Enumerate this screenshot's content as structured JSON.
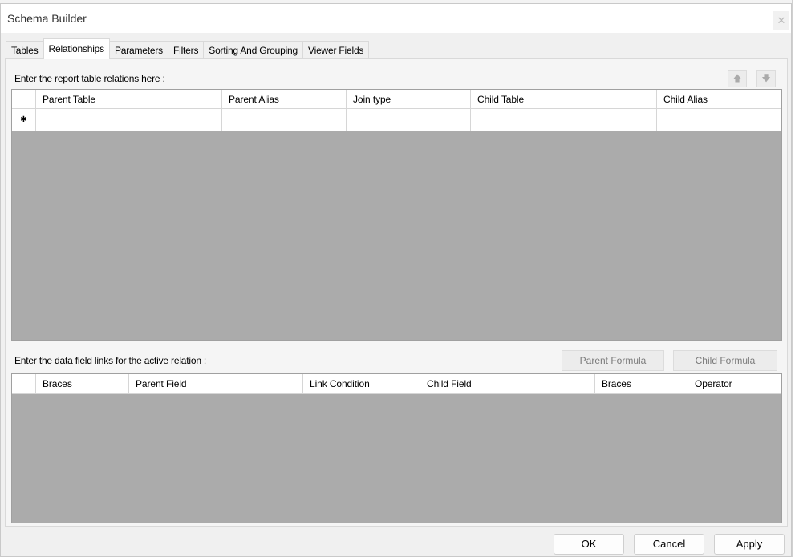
{
  "window": {
    "title": "Schema Builder",
    "close_glyph": "✕"
  },
  "tabs": [
    {
      "label": "Tables",
      "active": false
    },
    {
      "label": "Relationships",
      "active": true
    },
    {
      "label": "Parameters",
      "active": false
    },
    {
      "label": "Filters",
      "active": false
    },
    {
      "label": "Sorting And Grouping",
      "active": false
    },
    {
      "label": "Viewer Fields",
      "active": false
    }
  ],
  "relations": {
    "label": "Enter the report table relations here :",
    "move_up_glyph": "🡅",
    "move_down_glyph": "🡇",
    "columns": [
      "Parent Table",
      "Parent Alias",
      "Join type",
      "Child Table",
      "Child Alias"
    ],
    "new_row_marker": "✱"
  },
  "links": {
    "label": "Enter the data field links for the active relation :",
    "parent_formula": "Parent Formula",
    "child_formula": "Child Formula",
    "columns": [
      "Braces",
      "Parent Field",
      "Link Condition",
      "Child Field",
      "Braces",
      "Operator"
    ]
  },
  "footer": {
    "ok": "OK",
    "cancel": "Cancel",
    "apply": "Apply"
  },
  "colors": {
    "grid_empty": "#ababab",
    "dialog_bg": "#f0f0f0"
  }
}
